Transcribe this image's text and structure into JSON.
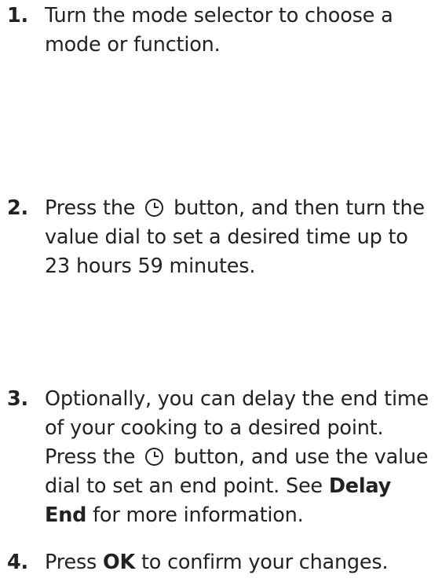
{
  "steps": [
    {
      "number": "1.",
      "text": "Turn the mode selector to choose a mode or function."
    },
    {
      "number": "2.",
      "text_before": "Press the",
      "text_after": "button, and then turn the value dial to set a desired time up to 23 hours 59 minutes.",
      "icon": "clock-icon"
    },
    {
      "number": "3.",
      "text_1": "Optionally, you can delay the end time of your cooking to a desired point. Press the",
      "text_2": "button, and use the value dial to set an end point. See",
      "link": "Delay End",
      "text_3": "for more information.",
      "icon": "clock-icon"
    },
    {
      "number": "4.",
      "text_before": "Press",
      "bold": "OK",
      "text_after": "to confirm your changes."
    }
  ]
}
